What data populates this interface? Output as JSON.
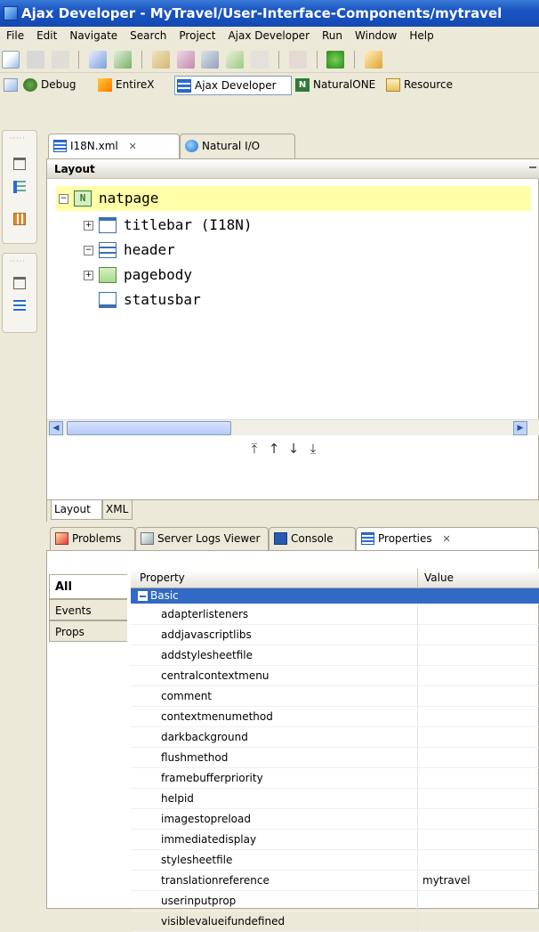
{
  "window": {
    "title": "Ajax Developer - MyTravel/User-Interface-Components/mytravel"
  },
  "menu": [
    "File",
    "Edit",
    "Navigate",
    "Search",
    "Project",
    "Ajax Developer",
    "Run",
    "Window",
    "Help"
  ],
  "perspectives": [
    "Debug",
    "EntireX",
    "Ajax Developer",
    "NaturalONE",
    "Resource"
  ],
  "editor_tabs": [
    {
      "label": "I18N.xml",
      "close": "✕"
    },
    {
      "label": "Natural I/O"
    }
  ],
  "layout": {
    "header": "Layout",
    "tree": [
      {
        "label": "natpage",
        "expander": "−"
      },
      {
        "label": "titlebar (I18N)",
        "expander": "+"
      },
      {
        "label": "header",
        "expander": "−"
      },
      {
        "label": "pagebody",
        "expander": "+"
      },
      {
        "label": "statusbar",
        "expander": ""
      }
    ],
    "move_arrows": [
      "⤒",
      "↑",
      "↓",
      "⤓"
    ],
    "bottom_tabs": [
      "Layout",
      "XML"
    ]
  },
  "panel": {
    "tabs": [
      {
        "label": "Problems"
      },
      {
        "label": "Server Logs Viewer"
      },
      {
        "label": "Console"
      },
      {
        "label": "Properties",
        "close": "✕"
      }
    ],
    "categories": [
      "All",
      "Events",
      "Props"
    ],
    "columns": {
      "property": "Property",
      "value": "Value"
    },
    "group": "Basic",
    "rows": [
      {
        "name": "adapterlisteners",
        "value": ""
      },
      {
        "name": "addjavascriptlibs",
        "value": ""
      },
      {
        "name": "addstylesheetfile",
        "value": ""
      },
      {
        "name": "centralcontextmenu",
        "value": ""
      },
      {
        "name": "comment",
        "value": ""
      },
      {
        "name": "contextmenumethod",
        "value": ""
      },
      {
        "name": "darkbackground",
        "value": ""
      },
      {
        "name": "flushmethod",
        "value": ""
      },
      {
        "name": "framebufferpriority",
        "value": ""
      },
      {
        "name": "helpid",
        "value": ""
      },
      {
        "name": "imagestopreload",
        "value": ""
      },
      {
        "name": "immediatedisplay",
        "value": ""
      },
      {
        "name": "stylesheetfile",
        "value": ""
      },
      {
        "name": "translationreference",
        "value": "mytravel"
      },
      {
        "name": "userinputprop",
        "value": ""
      },
      {
        "name": "visiblevalueifundefined",
        "value": ""
      }
    ]
  }
}
